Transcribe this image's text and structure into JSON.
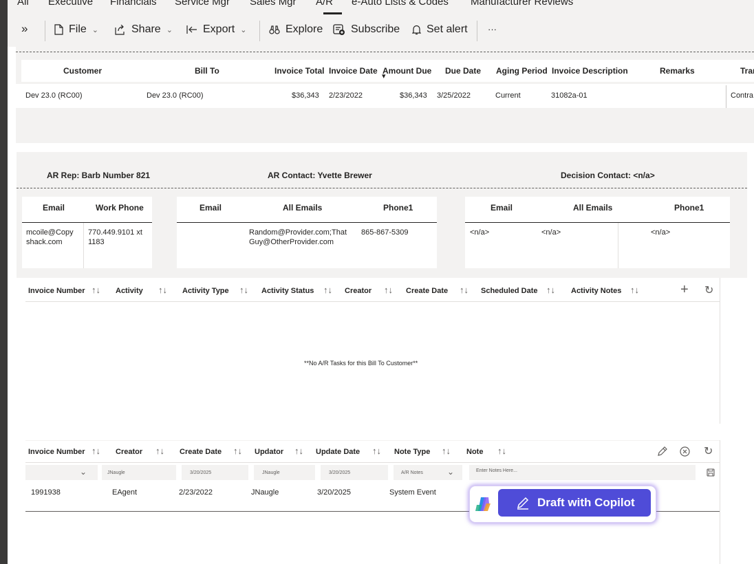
{
  "tabs": [
    "All",
    "Executive",
    "Financials",
    "Service Mgr",
    "Sales Mgr",
    "A/R",
    "e-Auto Lists & Codes",
    "Manufacturer Reviews"
  ],
  "toolbar": {
    "file": "File",
    "share": "Share",
    "export": "Export",
    "explore": "Explore",
    "subscribe": "Subscribe",
    "set_alert": "Set alert",
    "more": "···"
  },
  "invoice_table": {
    "headers": [
      "Customer",
      "Bill To",
      "Invoice Total",
      "Invoice Date",
      "Amount Due",
      "Due Date",
      "Aging Period",
      "Invoice Description",
      "Remarks",
      "Tran"
    ],
    "row": [
      "Dev 23.0 (RC00)",
      "Dev 23.0 (RC00)",
      "$36,343",
      "2/23/2022",
      "$36,343",
      "3/25/2022",
      "Current",
      "31082a-01",
      "",
      "Contra"
    ]
  },
  "contacts": {
    "ar_rep": "AR Rep: Barb Number 821",
    "ar_contact": "AR Contact: Yvette Brewer",
    "decision_contact": "Decision Contact: <n/a>",
    "rep": {
      "headers": [
        "Email",
        "Work Phone"
      ],
      "email_lines": [
        "mcoile@Copy",
        "shack.com"
      ],
      "phone_lines": [
        "770.449.9101 xt",
        "1183"
      ]
    },
    "ar": {
      "headers": [
        "Email",
        "All Emails",
        "Phone1"
      ],
      "all_emails_lines": [
        "Random@Provider.com;That",
        "Guy@OtherProvider.com"
      ],
      "phone": "865-867-5309"
    },
    "decision": {
      "headers": [
        "Email",
        "All Emails",
        "Phone1"
      ],
      "values": [
        "<n/a>",
        "<n/a>",
        "<n/a>"
      ]
    }
  },
  "tasks_table": {
    "headers": [
      "Invoice Number",
      "Activity",
      "Activity Type",
      "Activity Status",
      "Creator",
      "Create Date",
      "Scheduled Date",
      "Activity Notes"
    ],
    "empty_message": "**No A/R Tasks for this Bill To Customer**"
  },
  "notes_table": {
    "headers": [
      "Invoice Number",
      "Creator",
      "Create Date",
      "Updator",
      "Update Date",
      "Note Type",
      "Note"
    ],
    "input_row": {
      "creator": "JNaugle",
      "create_date": "3/20/2025",
      "updator": "JNaugle",
      "update_date": "3/20/2025",
      "note_type": "A/R Notes",
      "note_placeholder": "Enter Notes Here..."
    },
    "row": [
      "1991938",
      "EAgent",
      "2/23/2022",
      "JNaugle",
      "3/20/2025",
      "System Event"
    ]
  },
  "copilot": {
    "label": "Draft with Copilot"
  },
  "icons": {
    "sort": "↑↓",
    "add": "+",
    "refresh": "↻",
    "expand": "»",
    "chevron": "⌄",
    "sort_desc": "▾"
  }
}
